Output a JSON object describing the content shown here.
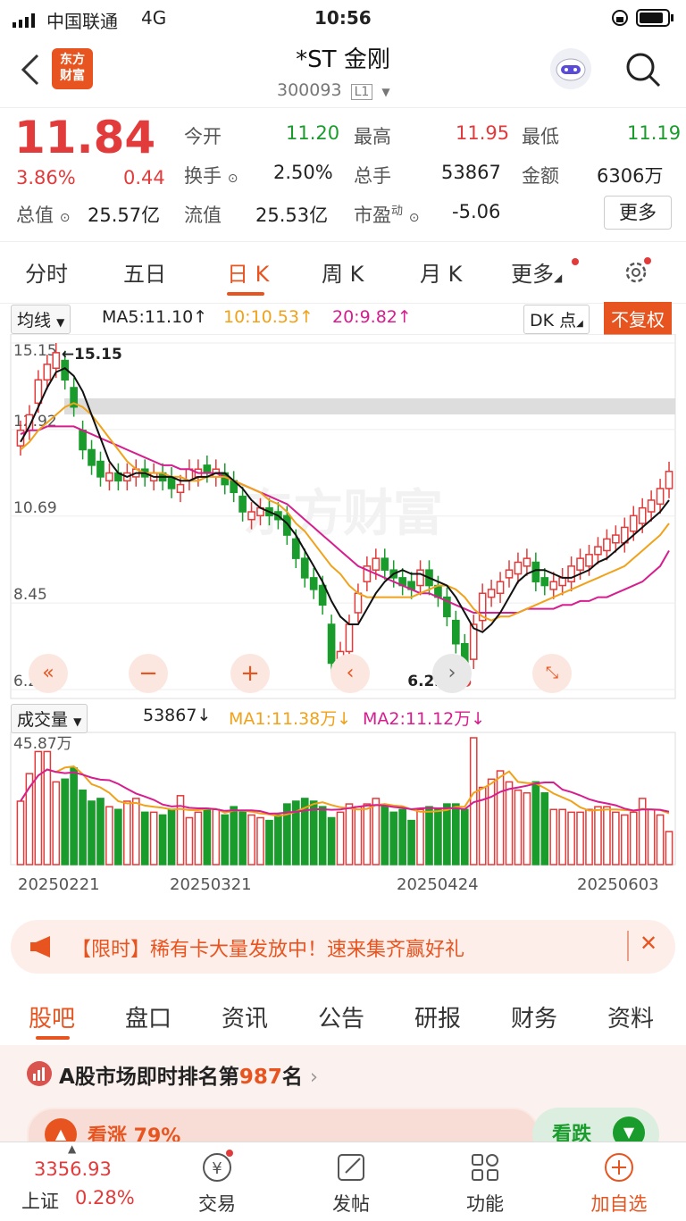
{
  "status": {
    "carrier": "中国联通",
    "network": "4G",
    "time": "10:56"
  },
  "header": {
    "logo_line1": "东方",
    "logo_line2": "财富",
    "name": "*ST 金刚",
    "code": "300093",
    "level": "L1"
  },
  "quote": {
    "price": "11.84",
    "pct": "3.86%",
    "chg": "0.44",
    "open_label": "今开",
    "open": "11.20",
    "high_label": "最高",
    "high": "11.95",
    "low_label": "最低",
    "low": "11.19",
    "turnover_label": "换手",
    "turnover": "2.50%",
    "vol_label": "总手",
    "vol": "53867",
    "amount_label": "金额",
    "amount": "6306万",
    "mktcap_label": "总值",
    "mktcap": "25.57亿",
    "float_label": "流值",
    "float": "25.53亿",
    "pe_label": "市盈",
    "pe_sup": "动",
    "pe": "-5.06",
    "more": "更多"
  },
  "period_tabs": [
    "分时",
    "五日",
    "日 K",
    "周 K",
    "月 K",
    "更多"
  ],
  "ma_bar": {
    "select": "均线",
    "ma5": "MA5:11.10↑",
    "ma10": "10:10.53↑",
    "ma20": "20:9.82↑",
    "dk": "DK 点",
    "fq": "不复权"
  },
  "chart_data": {
    "type": "candlestick",
    "y_ticks": [
      "15.15",
      "12.92",
      "10.69",
      "8.45",
      "6.22"
    ],
    "ylim": [
      6.22,
      15.15
    ],
    "high_label": "15.15",
    "low_label": "6.22→",
    "close": [
      12.9,
      13.3,
      14.2,
      14.6,
      14.9,
      14.2,
      13.5,
      12.4,
      12.0,
      11.7,
      11.8,
      11.6,
      11.8,
      11.9,
      11.7,
      11.8,
      11.6,
      11.4,
      11.5,
      11.9,
      11.9,
      11.8,
      11.9,
      11.5,
      11.3,
      10.8,
      10.8,
      10.9,
      10.7,
      10.6,
      10.2,
      9.6,
      9.1,
      8.8,
      8.4,
      6.9,
      7.2,
      7.9,
      8.7,
      9.4,
      9.6,
      9.3,
      9.1,
      8.9,
      8.8,
      9.3,
      8.9,
      8.6,
      8.1,
      7.4,
      6.9,
      7.9,
      8.7,
      8.8,
      9.0,
      9.3,
      9.5,
      9.6,
      9.0,
      8.9,
      9.0,
      9.1,
      9.4,
      9.6,
      9.7,
      9.9,
      10.1,
      10.2,
      10.4,
      10.7,
      10.9,
      11.1,
      11.4,
      11.84
    ],
    "open": [
      12.5,
      12.9,
      13.6,
      14.2,
      14.5,
      14.7,
      14.0,
      12.9,
      12.4,
      12.1,
      11.6,
      11.8,
      11.6,
      11.7,
      11.9,
      11.6,
      11.8,
      11.7,
      11.3,
      11.6,
      11.7,
      12.0,
      11.7,
      11.8,
      11.6,
      11.2,
      10.6,
      10.7,
      10.9,
      10.8,
      10.7,
      10.1,
      9.6,
      9.1,
      8.9,
      7.9,
      6.7,
      7.2,
      8.2,
      9.0,
      9.3,
      9.6,
      9.3,
      9.1,
      9.0,
      8.9,
      9.3,
      8.9,
      8.6,
      8.0,
      7.4,
      7.0,
      8.0,
      8.6,
      8.7,
      9.1,
      9.2,
      9.4,
      9.5,
      9.1,
      8.8,
      8.9,
      9.0,
      9.3,
      9.4,
      9.7,
      9.8,
      10.0,
      10.0,
      10.3,
      10.5,
      10.8,
      11.0,
      11.4
    ],
    "ma5": [
      12.6,
      13.0,
      13.5,
      14.0,
      14.4,
      14.5,
      14.3,
      13.9,
      13.3,
      12.7,
      12.1,
      11.8,
      11.7,
      11.8,
      11.8,
      11.7,
      11.7,
      11.7,
      11.6,
      11.6,
      11.7,
      11.7,
      11.8,
      11.8,
      11.6,
      11.4,
      11.1,
      10.9,
      10.8,
      10.7,
      10.5,
      10.2,
      9.8,
      9.4,
      9.0,
      8.5,
      8.1,
      7.9,
      7.9,
      8.3,
      8.7,
      9.0,
      9.2,
      9.3,
      9.2,
      9.2,
      9.1,
      9.0,
      8.9,
      8.6,
      8.2,
      7.8,
      7.7,
      7.9,
      8.2,
      8.6,
      9.0,
      9.2,
      9.3,
      9.3,
      9.2,
      9.1,
      9.1,
      9.2,
      9.3,
      9.5,
      9.6,
      9.8,
      10.0,
      10.2,
      10.4,
      10.6,
      10.8,
      11.1
    ],
    "ma10": [
      12.4,
      12.6,
      12.9,
      13.1,
      13.3,
      13.5,
      13.6,
      13.5,
      13.3,
      13.0,
      12.7,
      12.4,
      12.1,
      11.9,
      11.8,
      11.8,
      11.8,
      11.7,
      11.7,
      11.6,
      11.6,
      11.7,
      11.7,
      11.7,
      11.6,
      11.5,
      11.4,
      11.3,
      11.1,
      11.0,
      10.8,
      10.5,
      10.3,
      10.0,
      9.7,
      9.4,
      9.2,
      8.9,
      8.7,
      8.6,
      8.6,
      8.6,
      8.6,
      8.6,
      8.6,
      8.7,
      8.8,
      8.9,
      8.9,
      8.8,
      8.6,
      8.3,
      8.1,
      8.0,
      8.1,
      8.1,
      8.2,
      8.3,
      8.4,
      8.5,
      8.6,
      8.7,
      8.8,
      8.9,
      9.0,
      9.1,
      9.2,
      9.3,
      9.4,
      9.6,
      9.8,
      10.0,
      10.2,
      10.5
    ],
    "ma20": [
      12.8,
      12.9,
      12.9,
      13.0,
      13.0,
      13.0,
      13.0,
      12.9,
      12.8,
      12.7,
      12.6,
      12.5,
      12.4,
      12.3,
      12.2,
      12.1,
      12.0,
      12.0,
      11.9,
      11.9,
      11.8,
      11.8,
      11.8,
      11.7,
      11.6,
      11.5,
      11.4,
      11.3,
      11.2,
      11.1,
      11.0,
      10.8,
      10.6,
      10.4,
      10.2,
      10.0,
      9.8,
      9.6,
      9.4,
      9.3,
      9.2,
      9.1,
      9.0,
      8.9,
      8.8,
      8.7,
      8.7,
      8.6,
      8.5,
      8.4,
      8.3,
      8.2,
      8.2,
      8.2,
      8.2,
      8.2,
      8.2,
      8.3,
      8.3,
      8.3,
      8.3,
      8.4,
      8.4,
      8.5,
      8.5,
      8.6,
      8.6,
      8.7,
      8.8,
      8.9,
      9.0,
      9.2,
      9.4,
      9.8
    ],
    "dates": [
      "20250221",
      "20250321",
      "20250424",
      "20250603"
    ],
    "watermark": "东方财富"
  },
  "volume": {
    "select": "成交量",
    "vol": "53867↓",
    "ma1": "MA1:11.38万↓",
    "ma2": "MA2:11.12万↓",
    "max_label": "45.87万",
    "values": [
      23,
      33,
      41,
      41,
      30,
      31,
      35,
      27,
      23,
      24,
      21,
      20,
      23,
      24,
      19,
      19,
      18,
      20,
      25,
      17,
      19,
      20,
      20,
      18,
      21,
      19,
      18,
      17,
      16,
      18,
      22,
      23,
      24,
      23,
      21,
      17,
      19,
      22,
      21,
      22,
      24,
      21,
      19,
      20,
      16,
      20,
      21,
      20,
      22,
      22,
      20,
      46,
      28,
      31,
      34,
      30,
      27,
      26,
      30,
      26,
      20,
      20,
      19,
      19,
      20,
      21,
      21,
      19,
      18,
      19,
      24,
      20,
      18,
      12
    ]
  },
  "banner": {
    "text": "【限时】稀有卡大量发放中！速来集齐赢好礼"
  },
  "bottom_tabs": [
    "股吧",
    "盘口",
    "资讯",
    "公告",
    "研报",
    "财务",
    "资料"
  ],
  "rank": {
    "prefix": "A股市场即时排名第",
    "num": "987",
    "suffix": "名",
    "up": "看涨 79%",
    "down": "看跌"
  },
  "bottombar": {
    "index_val": "3356.93",
    "index_name": "上证",
    "index_pct": "0.28%",
    "trade": "交易",
    "post": "发帖",
    "func": "功能",
    "add": "加自选"
  }
}
